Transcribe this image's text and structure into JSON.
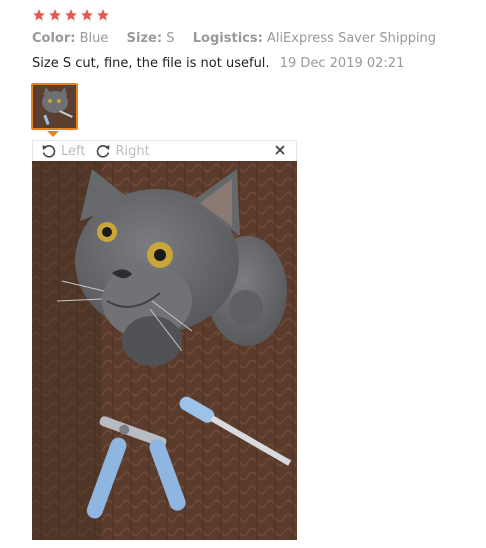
{
  "rating": {
    "stars": 5,
    "max": 5,
    "color": "#e8594b"
  },
  "attributes": {
    "color_label": "Color:",
    "color_value": "Blue",
    "size_label": "Size:",
    "size_value": "S",
    "logistics_label": "Logistics:",
    "logistics_value": "AliExpress Saver Shipping"
  },
  "review": {
    "text": "Size S cut, fine, the file is not useful.",
    "date": "19 Dec 2019 02:21"
  },
  "viewer": {
    "rotate_left_label": "Left",
    "rotate_right_label": "Right",
    "accent": "#e8821f",
    "photo_subject_icon": "cat-photo"
  }
}
